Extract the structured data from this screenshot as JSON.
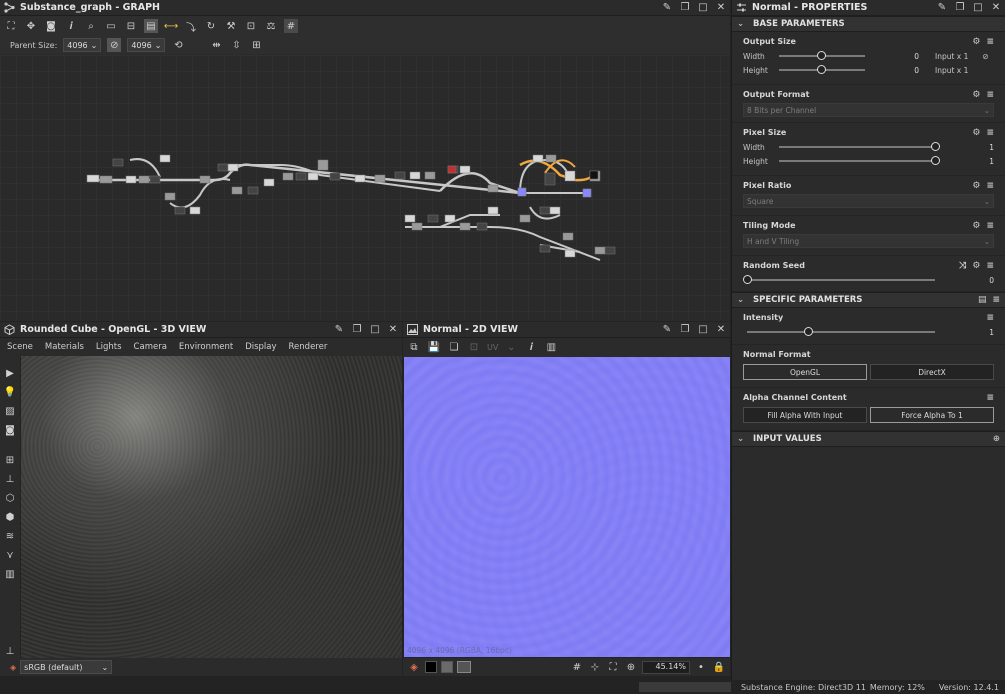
{
  "graph": {
    "title": "Substance_graph - GRAPH",
    "parent_size_label": "Parent Size:",
    "size_w": "4096",
    "size_h": "4096"
  },
  "view3d": {
    "title": "Rounded Cube - OpenGL - 3D VIEW",
    "menu": [
      "Scene",
      "Materials",
      "Lights",
      "Camera",
      "Environment",
      "Display",
      "Renderer"
    ],
    "colorspace": "sRGB (default)"
  },
  "view2d": {
    "title": "Normal - 2D VIEW",
    "uv_label": "UV",
    "overlay_text": "4096 x 4096 (RGBA, 16bpc)",
    "zoom": "45.14%"
  },
  "properties": {
    "title": "Normal - PROPERTIES",
    "base_header": "BASE PARAMETERS",
    "output_size": {
      "label": "Output Size",
      "width_label": "Width",
      "width_value": "0",
      "width_input": "Input x 1",
      "height_label": "Height",
      "height_value": "0",
      "height_input": "Input x 1"
    },
    "output_format": {
      "label": "Output Format",
      "value": "8 Bits per Channel"
    },
    "pixel_size": {
      "label": "Pixel Size",
      "width_label": "Width",
      "width_value": "1",
      "height_label": "Height",
      "height_value": "1"
    },
    "pixel_ratio": {
      "label": "Pixel Ratio",
      "value": "Square"
    },
    "tiling_mode": {
      "label": "Tiling Mode",
      "value": "H and V Tiling"
    },
    "random_seed": {
      "label": "Random Seed",
      "value": "0"
    },
    "specific_header": "SPECIFIC PARAMETERS",
    "intensity": {
      "label": "Intensity",
      "value": "1"
    },
    "normal_format": {
      "label": "Normal Format",
      "opt1": "OpenGL",
      "opt2": "DirectX"
    },
    "alpha_channel": {
      "label": "Alpha Channel Content",
      "opt1": "Fill Alpha With Input",
      "opt2": "Force Alpha To 1"
    },
    "input_header": "INPUT VALUES"
  },
  "status": {
    "engine": "Substance Engine: Direct3D 11",
    "memory": "Memory: 12%",
    "version": "Version: 12.4.1"
  }
}
